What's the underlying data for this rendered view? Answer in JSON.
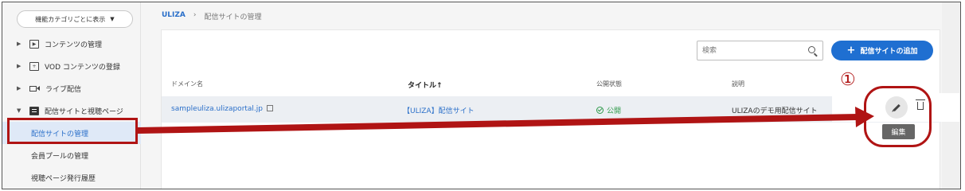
{
  "sidebar": {
    "category_button": "機能カテゴリごとに表示",
    "items": [
      {
        "label": "コンテンツの管理"
      },
      {
        "label": "VOD コンテンツの登録"
      },
      {
        "label": "ライブ配信"
      },
      {
        "label": "配信サイトと視聴ページ"
      }
    ],
    "sub_items": [
      {
        "label": "配信サイトの管理",
        "active": true
      },
      {
        "label": "会員プールの管理"
      },
      {
        "label": "視聴ページ発行履歴"
      }
    ]
  },
  "breadcrumb": {
    "root": "ULIZA",
    "separator": "›",
    "current": "配信サイトの管理"
  },
  "toolbar": {
    "search_placeholder": "検索",
    "add_button": "配信サイトの追加"
  },
  "table": {
    "headers": {
      "domain": "ドメイン名",
      "title": "タイトル↑",
      "status": "公開状態",
      "description": "説明"
    },
    "rows": [
      {
        "domain": "sampleuliza.ulizaportal.jp",
        "title": "【ULIZA】配信サイト",
        "status": "公開",
        "description": "ULIZAのデモ用配信サイト"
      }
    ]
  },
  "actions": {
    "edit_tooltip": "編集"
  },
  "annotation": {
    "number": "①",
    "color": "#b01414"
  },
  "colors": {
    "accent": "#1f6fd1",
    "status_green": "#2e9a4a",
    "highlight_red": "#b01414"
  }
}
